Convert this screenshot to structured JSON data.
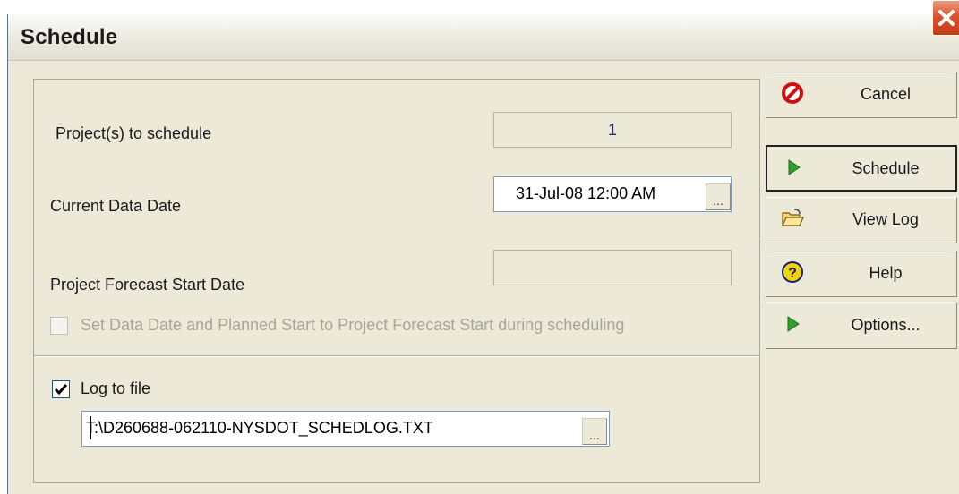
{
  "window": {
    "title": "Schedule"
  },
  "fields": {
    "projects_label": "Project(s) to schedule",
    "projects_value": "1",
    "data_date_label": "Current Data Date",
    "data_date_value": "31-Jul-08 12:00 AM",
    "forecast_label": "Project Forecast Start Date",
    "forecast_value": "",
    "set_data_date_label": "Set Data Date and Planned Start to Project Forecast Start during scheduling",
    "set_data_date_checked": false,
    "set_data_date_enabled": false,
    "log_to_file_label": "Log to file",
    "log_to_file_checked": true,
    "log_file_path": "T:\\D260688-062110-NYSDOT_SCHEDLOG.TXT",
    "ellipsis": "..."
  },
  "buttons": {
    "cancel": "Cancel",
    "schedule": "Schedule",
    "view_log": "View Log",
    "help": "Help",
    "options": "Options..."
  },
  "colors": {
    "dialog_bg": "#ece9d8",
    "close_button": "#d9542f",
    "go_arrow": "#2fa02f",
    "cancel_icon": "#cc1111",
    "help_icon": "#f1d400"
  }
}
